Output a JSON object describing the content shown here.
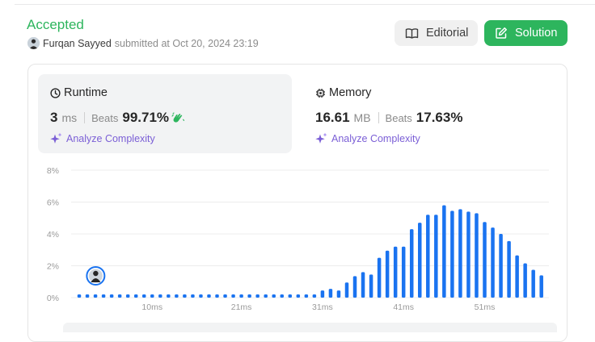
{
  "submission": {
    "status": "Accepted",
    "username": "Furqan Sayyed",
    "submitted_text": "submitted at Oct 20, 2024 23:19"
  },
  "actions": {
    "editorial_label": "Editorial",
    "solution_label": "Solution"
  },
  "runtime": {
    "title": "Runtime",
    "value": "3",
    "unit": "ms",
    "beats_label": "Beats",
    "beats_pct": "99.71%",
    "analyze_label": "Analyze Complexity"
  },
  "memory": {
    "title": "Memory",
    "value": "16.61",
    "unit": "MB",
    "beats_label": "Beats",
    "beats_pct": "17.63%",
    "analyze_label": "Analyze Complexity"
  },
  "colors": {
    "accent_green": "#2db55d",
    "bar_blue": "#1a73f0",
    "analyze_purple": "#7b5fd6"
  },
  "chart_data": {
    "type": "bar",
    "x_ticks": [
      "10ms",
      "21ms",
      "31ms",
      "41ms",
      "51ms"
    ],
    "y_ticks": [
      "0%",
      "2%",
      "4%",
      "6%",
      "8%"
    ],
    "ylim": [
      0,
      8
    ],
    "grid": true,
    "x": [
      1,
      2,
      3,
      4,
      5,
      6,
      7,
      8,
      9,
      10,
      11,
      12,
      13,
      14,
      15,
      16,
      17,
      18,
      19,
      20,
      21,
      22,
      23,
      24,
      25,
      26,
      27,
      28,
      29,
      30,
      31,
      32,
      33,
      34,
      35,
      36,
      37,
      38,
      39,
      40,
      41,
      42,
      43,
      44,
      45,
      46,
      47,
      48,
      49,
      50,
      51,
      52,
      53,
      54,
      55,
      56,
      57,
      58
    ],
    "values": [
      0.2,
      0.2,
      0.2,
      0.2,
      0.2,
      0.2,
      0.2,
      0.2,
      0.2,
      0.2,
      0.2,
      0.2,
      0.2,
      0.2,
      0.2,
      0.2,
      0.2,
      0.2,
      0.2,
      0.2,
      0.2,
      0.2,
      0.2,
      0.2,
      0.2,
      0.2,
      0.2,
      0.2,
      0.2,
      0.2,
      0.45,
      0.55,
      0.45,
      0.95,
      1.35,
      1.6,
      1.45,
      2.5,
      2.95,
      3.2,
      3.2,
      4.3,
      4.7,
      5.2,
      5.2,
      5.8,
      5.45,
      5.55,
      5.4,
      5.3,
      4.75,
      4.4,
      4.0,
      3.55,
      2.65,
      2.15,
      1.75,
      1.4
    ],
    "highlight_x": 3,
    "highlight_label": "your submission"
  }
}
